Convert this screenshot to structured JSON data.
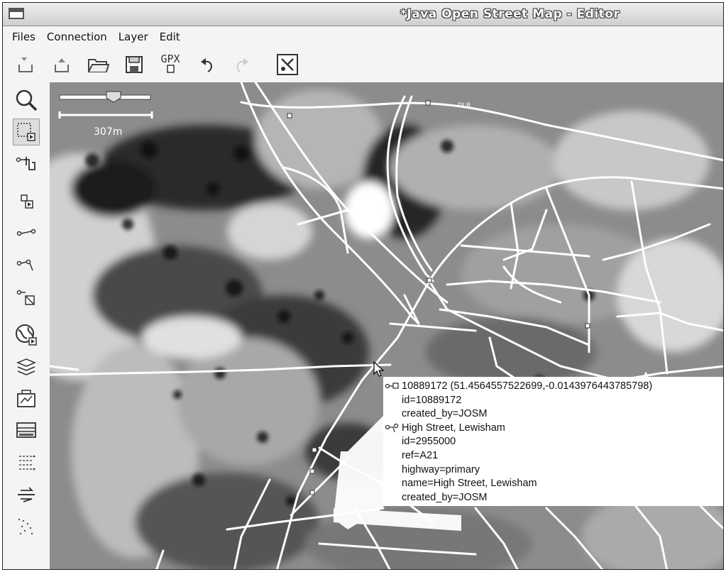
{
  "window": {
    "title": "*Java Open Street Map - Editor"
  },
  "menu": [
    {
      "label": "Files"
    },
    {
      "label": "Connection"
    },
    {
      "label": "Layer"
    },
    {
      "label": "Edit"
    }
  ],
  "toolbar": {
    "buttons": [
      {
        "icon": "download-icon"
      },
      {
        "icon": "upload-icon"
      },
      {
        "icon": "open-folder-icon"
      },
      {
        "icon": "save-icon"
      },
      {
        "icon": "gpx-export-icon",
        "label": "GPX"
      },
      {
        "icon": "undo-icon"
      },
      {
        "icon": "redo-icon",
        "disabled": true
      },
      {
        "icon": "preferences-icon"
      }
    ]
  },
  "sidebar": {
    "tools": [
      "zoom-icon",
      "select-icon",
      "move-icon",
      "add-node-icon",
      "add-segment-icon",
      "add-way-icon",
      "add-area-icon",
      "mapmode-icon",
      "layers-icon",
      "properties-icon",
      "conflict-icon",
      "list-icon",
      "align-icon",
      "gps-icon"
    ]
  },
  "map": {
    "scale": {
      "label": "307m",
      "zoom_level": 0.6
    },
    "road_label": "DLR",
    "tooltip": {
      "lines": [
        {
          "text": "10889172 (51.4564557522699,-0.0143976443785798)",
          "icon": "node-icon"
        },
        {
          "text": "id=10889172"
        },
        {
          "text": "created_by=JOSM"
        },
        {
          "text": "High Street, Lewisham",
          "icon": "segment-icon"
        },
        {
          "text": "id=2955000"
        },
        {
          "text": "ref=A21"
        },
        {
          "text": "highway=primary"
        },
        {
          "text": "name=High Street, Lewisham"
        },
        {
          "text": "created_by=JOSM"
        }
      ]
    }
  }
}
